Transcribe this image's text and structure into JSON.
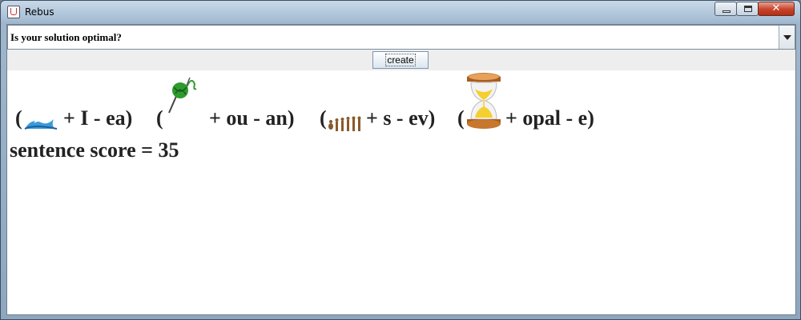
{
  "window": {
    "title": "Rebus",
    "close_symbol": "✕"
  },
  "combo": {
    "selected": "Is your solution optimal?"
  },
  "toolbar": {
    "create_label": "create"
  },
  "rebus": {
    "group1": {
      "open": "(",
      "rest": "+ I - ea)"
    },
    "group2": {
      "open": "(",
      "rest": "+ ou - an)"
    },
    "group3": {
      "open": "(",
      "rest": "+ s - ev)"
    },
    "group4": {
      "open": "(",
      "rest": "+ opal - e)"
    },
    "pictures": [
      "wave-icon",
      "yarn-ball-icon",
      "evolution-icon",
      "hourglass-icon"
    ]
  },
  "score": {
    "text": "sentence score = 35"
  }
}
